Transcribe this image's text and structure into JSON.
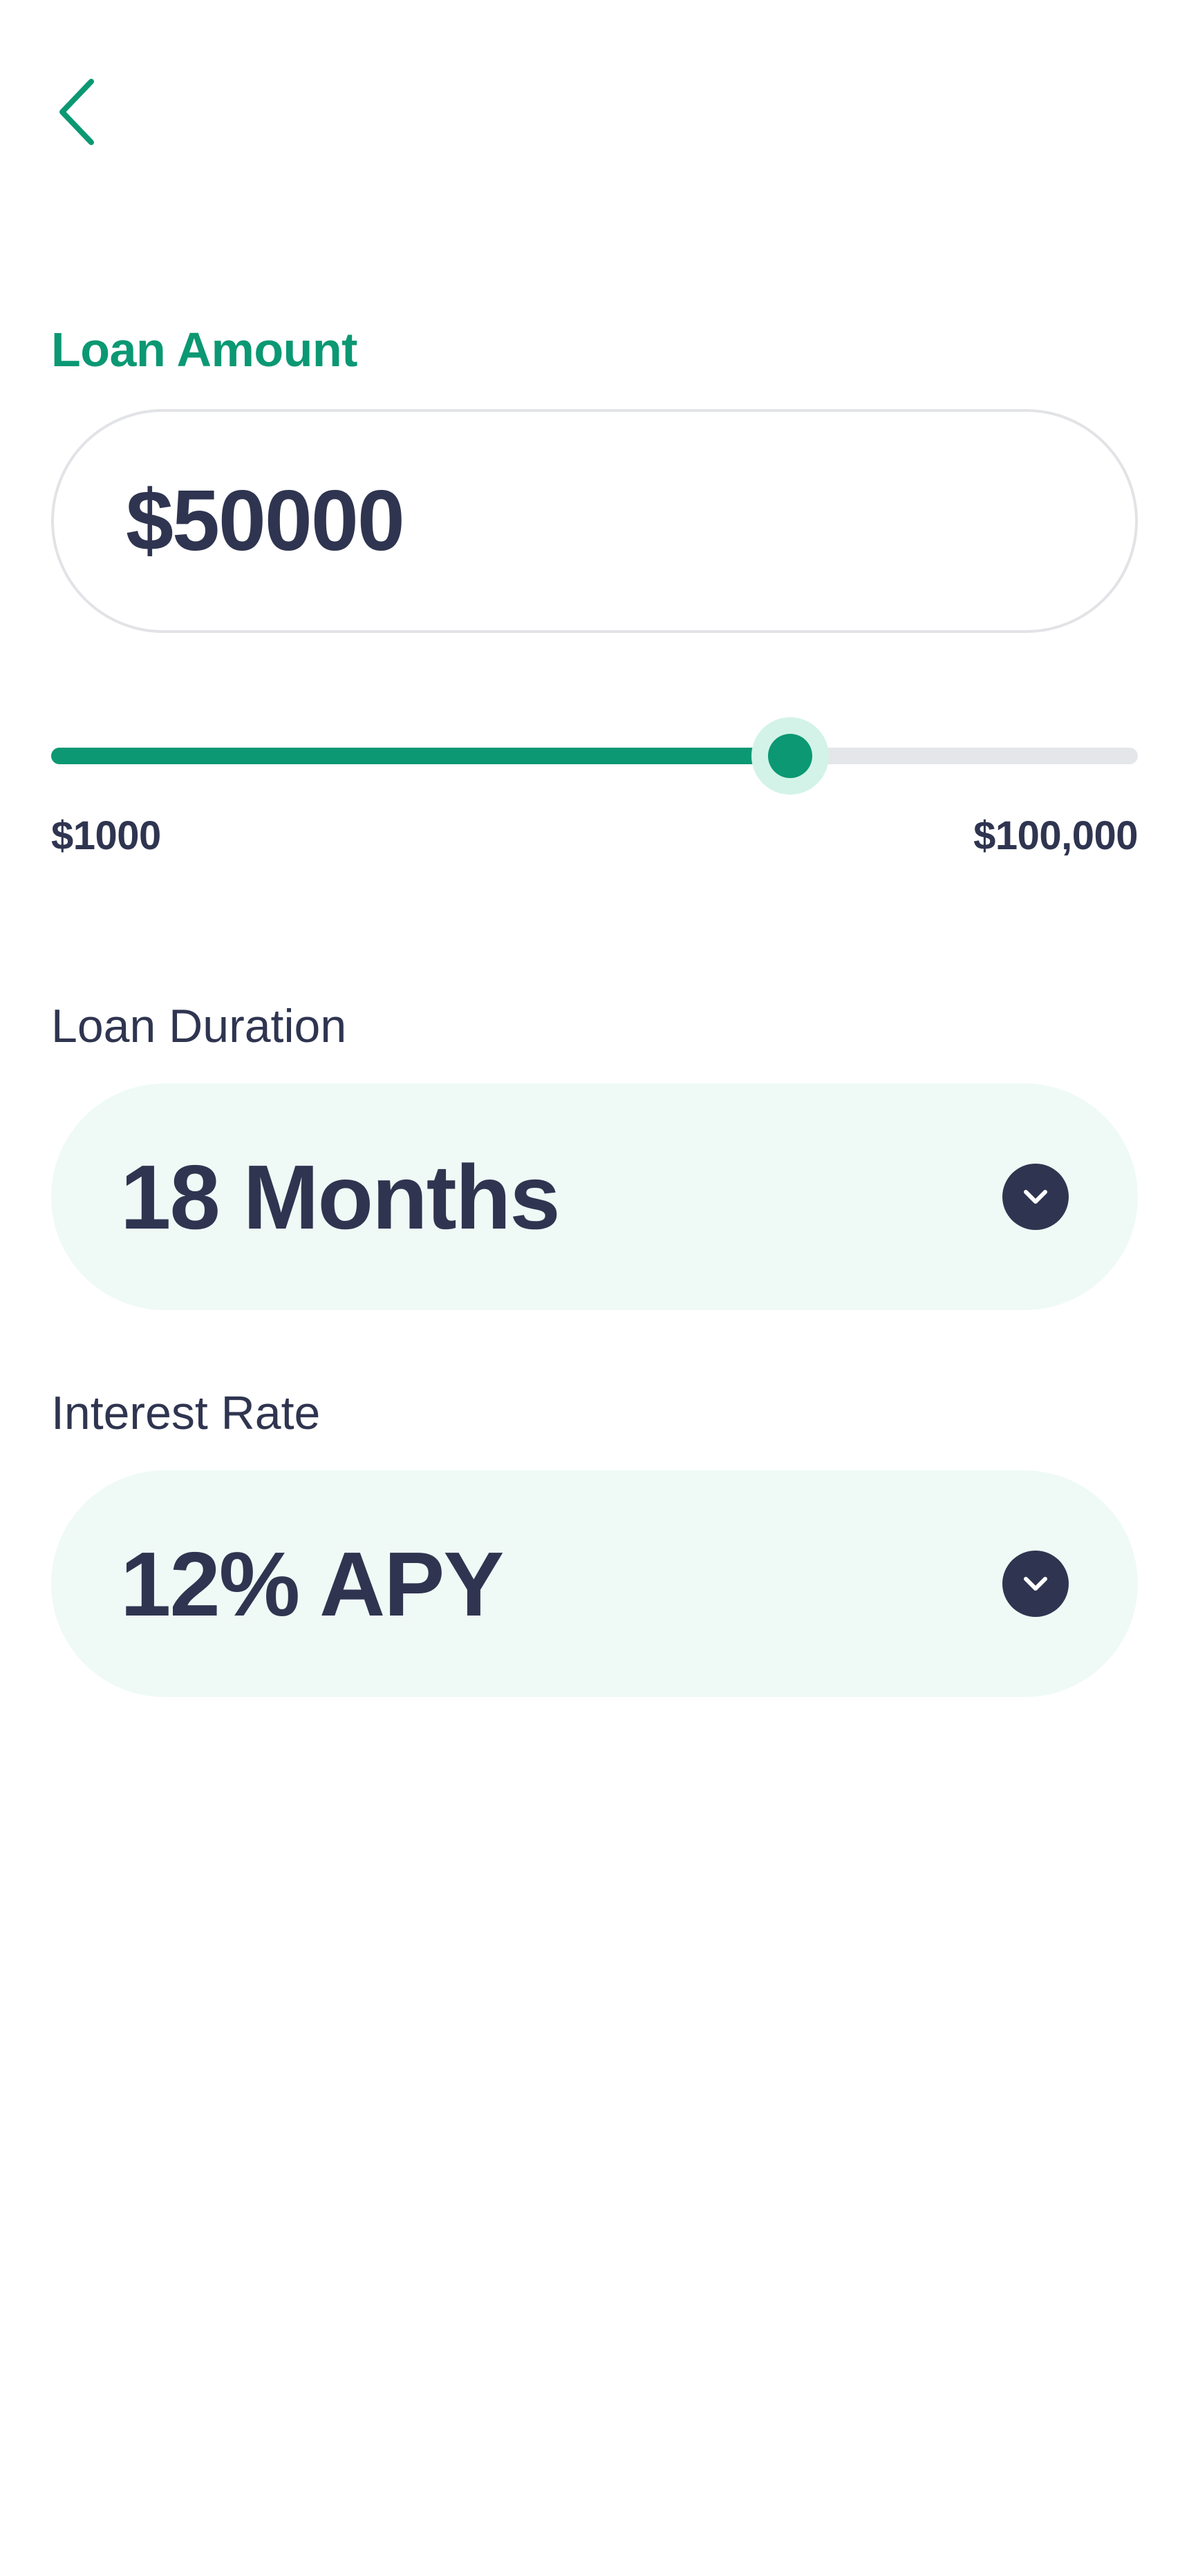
{
  "header": {
    "back_icon": "chevron-left-icon"
  },
  "loan_amount": {
    "label": "Loan Amount",
    "value": "$50000",
    "slider": {
      "min_label": "$1000",
      "max_label": "$100,000",
      "level": 0.68
    }
  },
  "loan_duration": {
    "label": "Loan Duration",
    "value": "18 Months",
    "icon": "chevron-down-icon"
  },
  "interest_rate": {
    "label": "Interest Rate",
    "value": "12% APY",
    "icon": "chevron-down-icon"
  },
  "colors": {
    "accent": "#0b9873",
    "text_dark": "#2f3550",
    "select_bg": "#effaf6",
    "thumb_halo": "#d3f3e8",
    "track": "#e4e6ea",
    "border": "#e2e3e6"
  }
}
